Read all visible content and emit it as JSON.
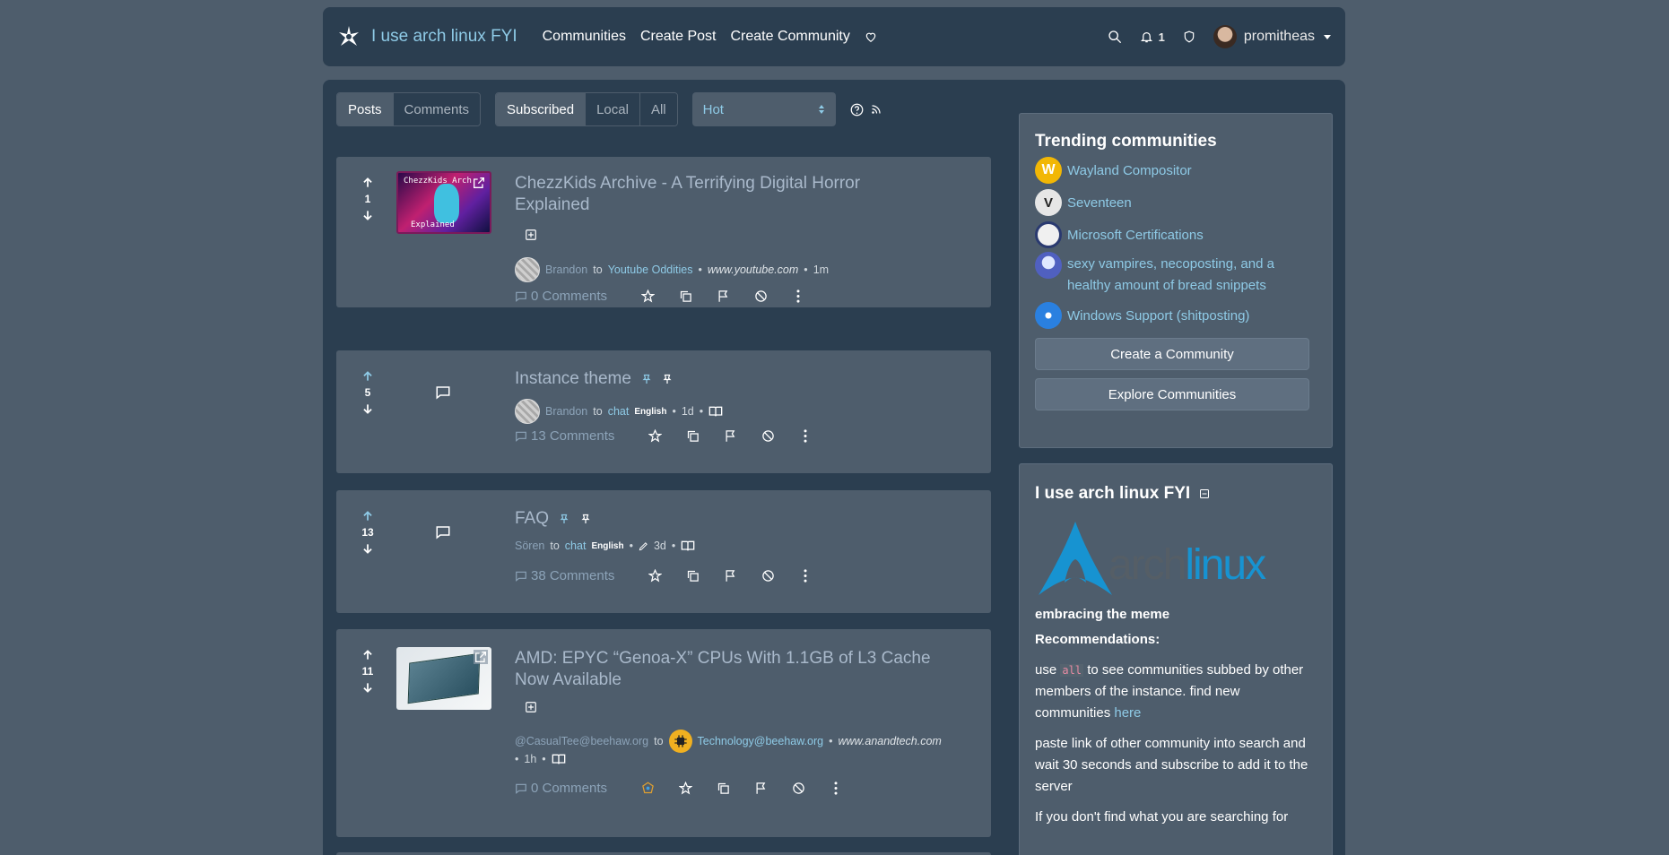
{
  "navbar": {
    "site_name": "I use arch linux FYI",
    "links": [
      "Communities",
      "Create Post",
      "Create Community"
    ],
    "notification_count": "1",
    "username": "promitheas"
  },
  "toolbar": {
    "view_tabs": [
      "Posts",
      "Comments"
    ],
    "listing_tabs": [
      "Subscribed",
      "Local",
      "All"
    ],
    "sort": "Hot"
  },
  "posts": [
    {
      "score": "1",
      "title": "ChezzKids Archive - A Terrifying Digital Horror Explained",
      "thumb_text_top": "ChezzKids Arch",
      "thumb_text_bottom": "Explained",
      "author": "Brandon",
      "to": "to",
      "community": "Youtube Oddities",
      "domain": "www.youtube.com",
      "age": "1m",
      "comments": "0 Comments"
    },
    {
      "score": "5",
      "title": "Instance theme",
      "author": "Brandon",
      "to": "to",
      "community": "chat",
      "language": "English",
      "age": "1d",
      "comments": "13 Comments"
    },
    {
      "score": "13",
      "title": "FAQ",
      "author": "Sören",
      "to": "to",
      "community": "chat",
      "language": "English",
      "age": "3d",
      "comments": "38 Comments"
    },
    {
      "score": "11",
      "title": "AMD: EPYC “Genoa-X” CPUs With 1.1GB of L3 Cache Now Available",
      "author": "@CasualTee@beehaw.org",
      "to": "to",
      "community": "Technology@beehaw.org",
      "domain": "www.anandtech.com",
      "age": "1h",
      "comments": "0 Comments"
    }
  ],
  "trending": {
    "title": "Trending communities",
    "items": [
      {
        "name": "Wayland Compositor",
        "color": "#f2b705"
      },
      {
        "name": "Seventeen",
        "color": "#e6e6e6"
      },
      {
        "name": "Microsoft Certifications",
        "color": "#f0f0f0"
      },
      {
        "name": "sexy vampires, necoposting, and a healthy amount of bread snippets",
        "color": "#5060c0"
      },
      {
        "name": "Windows Support (shitposting)",
        "color": "#2a80e0"
      }
    ],
    "create_btn": "Create a Community",
    "explore_btn": "Explore Communities"
  },
  "site_info": {
    "title": "I use arch linux FYI",
    "logo_arch": "arch",
    "logo_linux": "linux",
    "tagline": "embracing the meme",
    "rec_heading": "Recommendations:",
    "p1_a": "use ",
    "p1_code": "all",
    "p1_b": " to see communities subbed by other members of the instance. find new communities ",
    "p1_link": "here",
    "p2": "paste link of other community into search and wait 30 seconds and subscribe to add it to the server",
    "p3": "If you don't find what you are searching for"
  },
  "colors": {
    "background": "#4e5d6c",
    "panel": "#2b3e50",
    "link": "#8ecae6"
  }
}
